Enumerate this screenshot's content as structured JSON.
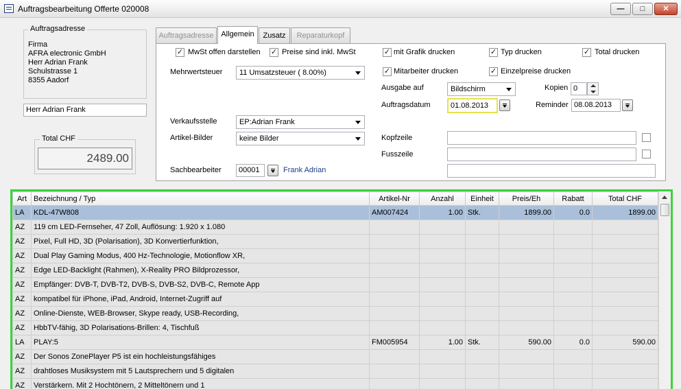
{
  "window": {
    "title": "Auftragsbearbeitung  Offerte  020008",
    "minimize": "—",
    "maximize": "□",
    "close": "✕"
  },
  "address": {
    "group_title": "Auftragsadresse",
    "lines": [
      "Firma",
      "AFRA electronic GmbH",
      "Herr Adrian Frank",
      "Schulstrasse 1",
      "8355 Aadorf"
    ],
    "contact": "Herr Adrian Frank"
  },
  "total": {
    "label": "Total CHF",
    "value": "2489.00"
  },
  "tabs": [
    {
      "label": "Auftragsadresse",
      "state": "disabled"
    },
    {
      "label": "Allgemein",
      "state": "active"
    },
    {
      "label": "Zusatz",
      "state": "enabled"
    },
    {
      "label": "Reparaturkopf",
      "state": "disabled"
    }
  ],
  "options": {
    "mwst_offen": {
      "label": "MwSt offen darstellen",
      "checked": true
    },
    "preise_inkl": {
      "label": "Preise sind inkl. MwSt",
      "checked": true
    },
    "mit_grafik": {
      "label": "mit Grafik drucken",
      "checked": true
    },
    "typ": {
      "label": "Typ drucken",
      "checked": true
    },
    "total": {
      "label": "Total drucken",
      "checked": true
    },
    "mitarbeiter": {
      "label": "Mitarbeiter drucken",
      "checked": true
    },
    "einzelpreise": {
      "label": "Einzelpreise drucken",
      "checked": true
    }
  },
  "form": {
    "mwst_label": "Mehrwertsteuer",
    "mwst_value": "11  Umsatzsteuer  ( 8.00%)",
    "ausgabe_label": "Ausgabe auf",
    "ausgabe_value": "Bildschirm",
    "kopien_label": "Kopien",
    "kopien_value": "0",
    "auftragsdatum_label": "Auftragsdatum",
    "auftragsdatum_value": "01.08.2013",
    "reminder_label": "Reminder",
    "reminder_value": "08.08.2013",
    "verkaufsstelle_label": "Verkaufsstelle",
    "verkaufsstelle_value": "EP:Adrian Frank",
    "artikelbilder_label": "Artikel-Bilder",
    "artikelbilder_value": "keine Bilder",
    "kopfzeile_label": "Kopfzeile",
    "kopfzeile_value": "",
    "fusszeile_label": "Fusszeile",
    "fusszeile_value": "",
    "sachbearbeiter_label": "Sachbearbeiter",
    "sachbearbeiter_value": "00001",
    "sachbearbeiter_name": "Frank Adrian"
  },
  "grid": {
    "columns": [
      "Art",
      "Bezeichnung / Typ",
      "Artikel-Nr",
      "Anzahl",
      "Einheit",
      "Preis/Eh",
      "Rabatt",
      "Total CHF"
    ],
    "rows": [
      [
        "LA",
        "KDL-47W808",
        "AM007424",
        "1.00",
        "Stk.",
        "1899.00",
        "0.0",
        "1899.00"
      ],
      [
        "AZ",
        "119 cm LED-Fernseher, 47 Zoll, Auflösung: 1.920 x 1.080",
        "",
        "",
        "",
        "",
        "",
        ""
      ],
      [
        "AZ",
        "Pixel, Full HD, 3D (Polarisation), 3D Konvertierfunktion,",
        "",
        "",
        "",
        "",
        "",
        ""
      ],
      [
        "AZ",
        "Dual Play Gaming Modus, 400 Hz-Technologie, Motionflow XR,",
        "",
        "",
        "",
        "",
        "",
        ""
      ],
      [
        "AZ",
        "Edge LED-Backlight (Rahmen), X-Reality PRO Bildprozessor,",
        "",
        "",
        "",
        "",
        "",
        ""
      ],
      [
        "AZ",
        "Empfänger: DVB-T, DVB-T2, DVB-S, DVB-S2, DVB-C, Remote App",
        "",
        "",
        "",
        "",
        "",
        ""
      ],
      [
        "AZ",
        "kompatibel für iPhone, iPad, Android, Internet-Zugriff auf",
        "",
        "",
        "",
        "",
        "",
        ""
      ],
      [
        "AZ",
        "Online-Dienste, WEB-Browser, Skype ready, USB-Recording,",
        "",
        "",
        "",
        "",
        "",
        ""
      ],
      [
        "AZ",
        "HbbTV-fähig, 3D Polarisations-Brillen: 4, Tischfuß",
        "",
        "",
        "",
        "",
        "",
        ""
      ],
      [
        "LA",
        "PLAY:5",
        "FM005954",
        "1.00",
        "Stk.",
        "590.00",
        "0.0",
        "590.00"
      ],
      [
        "AZ",
        "Der Sonos ZonePlayer P5 ist ein hochleistungsfähiges",
        "",
        "",
        "",
        "",
        "",
        ""
      ],
      [
        "AZ",
        "drahtloses Musiksystem mit 5 Lautsprechern und 5 digitalen",
        "",
        "",
        "",
        "",
        "",
        ""
      ],
      [
        "AZ",
        "Verstärkern. Mit 2 Hochtönern, 2 Mitteltönern und 1",
        "",
        "",
        "",
        "",
        "",
        ""
      ]
    ]
  }
}
